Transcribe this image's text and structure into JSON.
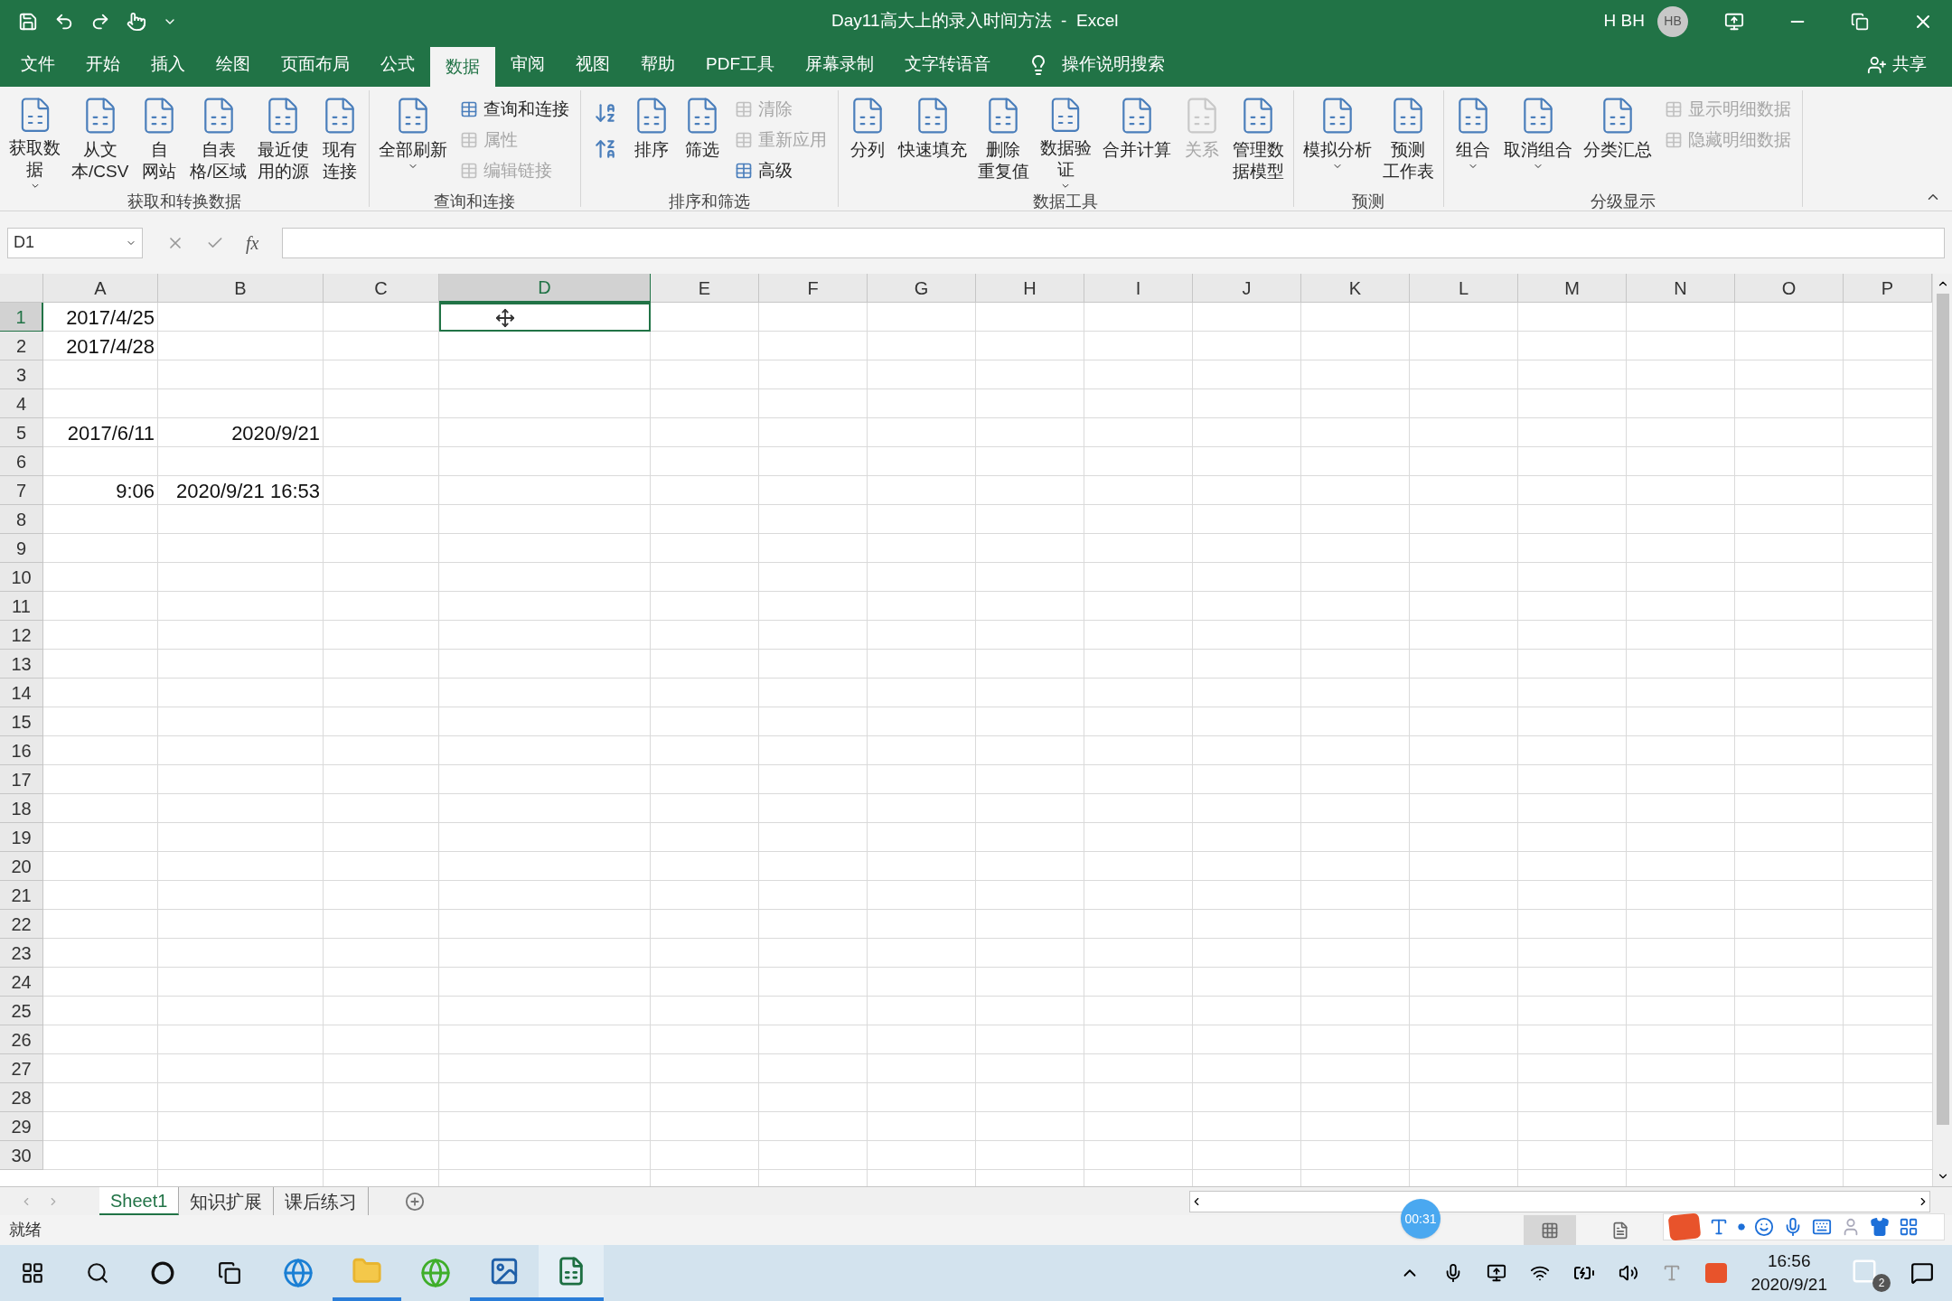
{
  "title_bar": {
    "title": "Day11高大上的录入时间方法  -  Excel",
    "user": "H BH",
    "avatar": "HB"
  },
  "menu_tabs": [
    {
      "label": "文件",
      "selected": false
    },
    {
      "label": "开始",
      "selected": false
    },
    {
      "label": "插入",
      "selected": false
    },
    {
      "label": "绘图",
      "selected": false
    },
    {
      "label": "页面布局",
      "selected": false
    },
    {
      "label": "公式",
      "selected": false
    },
    {
      "label": "数据",
      "selected": true
    },
    {
      "label": "审阅",
      "selected": false
    },
    {
      "label": "视图",
      "selected": false
    },
    {
      "label": "帮助",
      "selected": false
    },
    {
      "label": "PDF工具",
      "selected": false
    },
    {
      "label": "屏幕录制",
      "selected": false
    },
    {
      "label": "文字转语音",
      "selected": false
    }
  ],
  "tell_me": "操作说明搜索",
  "share": "共享",
  "ribbon_groups": [
    {
      "label": "获取和转换数据",
      "items": [
        {
          "kind": "large",
          "lines": [
            "获取数",
            "据"
          ],
          "dropdown": true,
          "disabled": false
        },
        {
          "kind": "large",
          "lines": [
            "从文",
            "本/CSV"
          ],
          "dropdown": false,
          "disabled": false
        },
        {
          "kind": "large",
          "lines": [
            "自",
            "网站"
          ],
          "dropdown": false,
          "disabled": false
        },
        {
          "kind": "large",
          "lines": [
            "自表",
            "格/区域"
          ],
          "dropdown": false,
          "disabled": false
        },
        {
          "kind": "large",
          "lines": [
            "最近使",
            "用的源"
          ],
          "dropdown": false,
          "disabled": false
        },
        {
          "kind": "large",
          "lines": [
            "现有",
            "连接"
          ],
          "dropdown": false,
          "disabled": false
        }
      ]
    },
    {
      "label": "查询和连接",
      "items": [
        {
          "kind": "large",
          "lines": [
            "全部刷新"
          ],
          "dropdown": true,
          "disabled": false
        },
        {
          "kind": "stack",
          "buttons": [
            {
              "label": "查询和连接",
              "disabled": false
            },
            {
              "label": "属性",
              "disabled": true
            },
            {
              "label": "编辑链接",
              "disabled": true
            }
          ]
        }
      ]
    },
    {
      "label": "排序和筛选",
      "items": [
        {
          "kind": "sort"
        },
        {
          "kind": "large",
          "lines": [
            "排序"
          ],
          "dropdown": false,
          "disabled": false
        },
        {
          "kind": "large",
          "lines": [
            "筛选"
          ],
          "dropdown": false,
          "disabled": false
        },
        {
          "kind": "stack",
          "buttons": [
            {
              "label": "清除",
              "disabled": true
            },
            {
              "label": "重新应用",
              "disabled": true
            },
            {
              "label": "高级",
              "disabled": false
            }
          ]
        }
      ]
    },
    {
      "label": "数据工具",
      "items": [
        {
          "kind": "large",
          "lines": [
            "分列"
          ],
          "dropdown": false,
          "disabled": false
        },
        {
          "kind": "large",
          "lines": [
            "快速填充"
          ],
          "dropdown": false,
          "disabled": false
        },
        {
          "kind": "large",
          "lines": [
            "删除",
            "重复值"
          ],
          "dropdown": false,
          "disabled": false
        },
        {
          "kind": "large",
          "lines": [
            "数据验",
            "证"
          ],
          "dropdown": true,
          "disabled": false
        },
        {
          "kind": "large",
          "lines": [
            "合并计算"
          ],
          "dropdown": false,
          "disabled": false
        },
        {
          "kind": "large",
          "lines": [
            "关系"
          ],
          "dropdown": false,
          "disabled": true
        },
        {
          "kind": "large",
          "lines": [
            "管理数",
            "据模型"
          ],
          "dropdown": false,
          "disabled": false
        }
      ]
    },
    {
      "label": "预测",
      "items": [
        {
          "kind": "large",
          "lines": [
            "模拟分析"
          ],
          "dropdown": true,
          "disabled": false
        },
        {
          "kind": "large",
          "lines": [
            "预测",
            "工作表"
          ],
          "dropdown": false,
          "disabled": false
        }
      ]
    },
    {
      "label": "分级显示",
      "items": [
        {
          "kind": "large",
          "lines": [
            "组合"
          ],
          "dropdown": true,
          "disabled": false
        },
        {
          "kind": "large",
          "lines": [
            "取消组合"
          ],
          "dropdown": true,
          "disabled": false
        },
        {
          "kind": "large",
          "lines": [
            "分类汇总"
          ],
          "dropdown": false,
          "disabled": false
        },
        {
          "kind": "stack",
          "buttons": [
            {
              "label": "显示明细数据",
              "disabled": true
            },
            {
              "label": "隐藏明细数据",
              "disabled": true
            }
          ]
        }
      ]
    }
  ],
  "name_box": "D1",
  "formula_fx": "fx",
  "columns": [
    {
      "label": "A",
      "selected": false
    },
    {
      "label": "B",
      "selected": false
    },
    {
      "label": "C",
      "selected": false
    },
    {
      "label": "D",
      "selected": true
    },
    {
      "label": "E",
      "selected": false
    },
    {
      "label": "F",
      "selected": false
    },
    {
      "label": "G",
      "selected": false
    },
    {
      "label": "H",
      "selected": false
    },
    {
      "label": "I",
      "selected": false
    },
    {
      "label": "J",
      "selected": false
    },
    {
      "label": "K",
      "selected": false
    },
    {
      "label": "L",
      "selected": false
    },
    {
      "label": "M",
      "selected": false
    },
    {
      "label": "N",
      "selected": false
    },
    {
      "label": "O",
      "selected": false
    },
    {
      "label": "P",
      "selected": false
    }
  ],
  "rows": [
    {
      "header": "1",
      "selected": true,
      "cells": [
        "2017/4/25"
      ]
    },
    {
      "header": "2",
      "selected": false,
      "cells": [
        "2017/4/28"
      ]
    },
    {
      "header": "3",
      "selected": false
    },
    {
      "header": "4",
      "selected": false
    },
    {
      "header": "5",
      "selected": false,
      "cells": [
        "2017/6/11",
        "2020/9/21"
      ]
    },
    {
      "header": "6",
      "selected": false
    },
    {
      "header": "7",
      "selected": false,
      "cells": [
        "9:06",
        "2020/9/21 16:53"
      ]
    },
    {
      "header": "8",
      "selected": false
    },
    {
      "header": "9",
      "selected": false
    },
    {
      "header": "10",
      "selected": false
    },
    {
      "header": "11",
      "selected": false
    },
    {
      "header": "12",
      "selected": false
    },
    {
      "header": "13",
      "selected": false
    },
    {
      "header": "14",
      "selected": false
    },
    {
      "header": "15",
      "selected": false
    },
    {
      "header": "16",
      "selected": false
    },
    {
      "header": "17",
      "selected": false
    },
    {
      "header": "18",
      "selected": false
    },
    {
      "header": "19",
      "selected": false
    },
    {
      "header": "20",
      "selected": false
    },
    {
      "header": "21",
      "selected": false
    },
    {
      "header": "22",
      "selected": false
    },
    {
      "header": "23",
      "selected": false
    },
    {
      "header": "24",
      "selected": false
    },
    {
      "header": "25",
      "selected": false
    },
    {
      "header": "26",
      "selected": false
    },
    {
      "header": "27",
      "selected": false
    },
    {
      "header": "28",
      "selected": false
    },
    {
      "header": "29",
      "selected": false
    },
    {
      "header": "30",
      "selected": false
    }
  ],
  "sheet_tabs": [
    {
      "label": "Sheet1",
      "selected": true
    },
    {
      "label": "知识扩展",
      "selected": false
    },
    {
      "label": "课后练习",
      "selected": false
    }
  ],
  "status": "就绪",
  "recording_timer": "00:31",
  "taskbar": {
    "time": "16:56",
    "date": "2020/9/21",
    "notification_count": "2"
  }
}
